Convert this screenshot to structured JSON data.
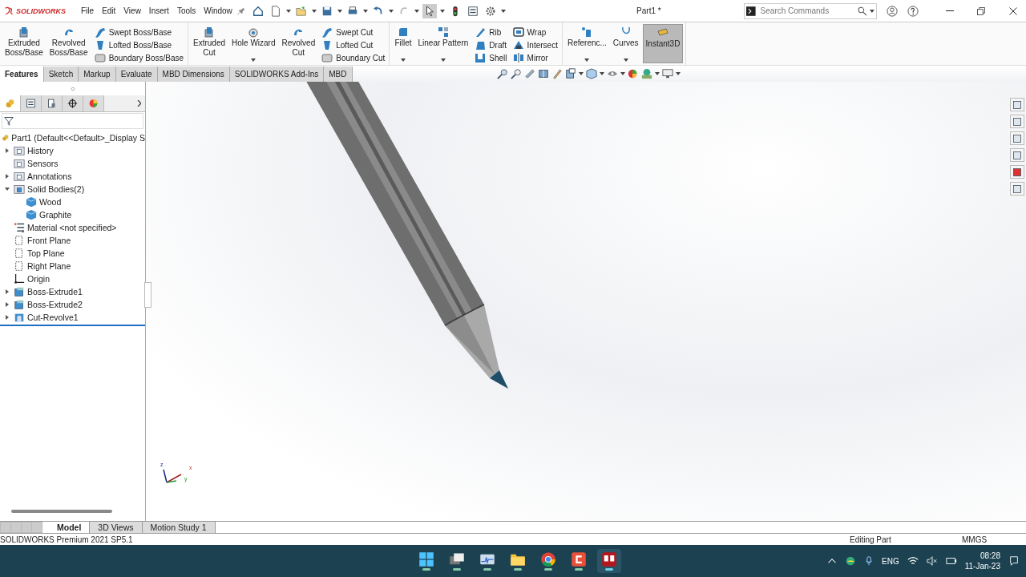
{
  "app": {
    "logo": "SOLIDWORKS"
  },
  "menu": [
    "File",
    "Edit",
    "View",
    "Insert",
    "Tools",
    "Window"
  ],
  "window": {
    "title": "Part1 *"
  },
  "search": {
    "placeholder": "Search Commands"
  },
  "ribbon": {
    "groups": [
      {
        "large": [
          {
            "lines": [
              "Extruded",
              "Boss/Base"
            ],
            "dropdown": false,
            "selected": false
          },
          {
            "lines": [
              "Revolved",
              "Boss/Base"
            ],
            "dropdown": false,
            "selected": false
          }
        ],
        "small": [
          {
            "label": "Swept Boss/Base"
          },
          {
            "label": "Lofted Boss/Base"
          },
          {
            "label": "Boundary Boss/Base"
          }
        ]
      },
      {
        "large": [
          {
            "lines": [
              "Extruded",
              "Cut"
            ],
            "dropdown": false,
            "selected": false
          },
          {
            "lines": [
              "Hole Wizard"
            ],
            "dropdown": true,
            "selected": false
          },
          {
            "lines": [
              "Revolved",
              "Cut"
            ],
            "dropdown": false,
            "selected": false
          }
        ],
        "small": [
          {
            "label": "Swept Cut"
          },
          {
            "label": "Lofted Cut"
          },
          {
            "label": "Boundary Cut"
          }
        ]
      },
      {
        "large": [
          {
            "lines": [
              "Fillet"
            ],
            "dropdown": true,
            "selected": false
          },
          {
            "lines": [
              "Linear Pattern"
            ],
            "dropdown": true,
            "selected": false
          }
        ],
        "small": [
          {
            "label": "Rib"
          },
          {
            "label": "Draft"
          },
          {
            "label": "Shell"
          }
        ],
        "small2": [
          {
            "label": "Wrap"
          },
          {
            "label": "Intersect"
          },
          {
            "label": "Mirror"
          }
        ]
      },
      {
        "large": [
          {
            "lines": [
              "Referenc..."
            ],
            "dropdown": true,
            "selected": false
          },
          {
            "lines": [
              "Curves"
            ],
            "dropdown": true,
            "selected": false
          },
          {
            "lines": [
              "Instant3D"
            ],
            "dropdown": false,
            "selected": true
          }
        ]
      }
    ]
  },
  "command_tabs": [
    {
      "label": "Features",
      "selected": true
    },
    {
      "label": "Sketch",
      "selected": false
    },
    {
      "label": "Markup",
      "selected": false
    },
    {
      "label": "Evaluate",
      "selected": false
    },
    {
      "label": "MBD Dimensions",
      "selected": false
    },
    {
      "label": "SOLIDWORKS Add-Ins",
      "selected": false
    },
    {
      "label": "MBD",
      "selected": false
    }
  ],
  "panel_tabs": [
    {
      "selected": true
    },
    {
      "selected": false
    },
    {
      "selected": false
    },
    {
      "selected": false
    },
    {
      "selected": false
    }
  ],
  "tree": {
    "root": {
      "label": "Part1  (Default<<Default>_Display S",
      "kind": "part"
    },
    "items": [
      {
        "label": "History",
        "kind": "history",
        "expanded": false
      },
      {
        "label": "Sensors",
        "kind": "sensors"
      },
      {
        "label": "Annotations",
        "kind": "annotations",
        "expanded": false
      },
      {
        "label": "Solid Bodies(2)",
        "kind": "bodies",
        "expanded": true,
        "children": [
          {
            "label": "Wood",
            "kind": "body"
          },
          {
            "label": "Graphite",
            "kind": "body"
          }
        ]
      },
      {
        "label": "Material <not specified>",
        "kind": "material"
      },
      {
        "label": "Front Plane",
        "kind": "plane"
      },
      {
        "label": "Top Plane",
        "kind": "plane"
      },
      {
        "label": "Right Plane",
        "kind": "plane"
      },
      {
        "label": "Origin",
        "kind": "origin"
      },
      {
        "label": "Boss-Extrude1",
        "kind": "feature",
        "expanded": false
      },
      {
        "label": "Boss-Extrude2",
        "kind": "feature",
        "expanded": false
      },
      {
        "label": "Cut-Revolve1",
        "kind": "cut",
        "expanded": false
      }
    ]
  },
  "triad": {
    "x": "x",
    "y": "y",
    "z": "z"
  },
  "bottom_tabs": [
    {
      "label": "Model",
      "selected": true
    },
    {
      "label": "3D Views",
      "selected": false
    },
    {
      "label": "Motion Study 1",
      "selected": false
    }
  ],
  "status_bar": {
    "product": "SOLIDWORKS Premium 2021 SP5.1",
    "mode": "Editing Part",
    "units": "MMGS"
  },
  "taskbar": {
    "apps": [
      {
        "active": false
      },
      {
        "active": false
      },
      {
        "active": false
      },
      {
        "active": false
      },
      {
        "active": false
      },
      {
        "active": false
      },
      {
        "active": true
      }
    ],
    "language": "ENG",
    "time": "08:28",
    "date": "11-Jan-23"
  }
}
